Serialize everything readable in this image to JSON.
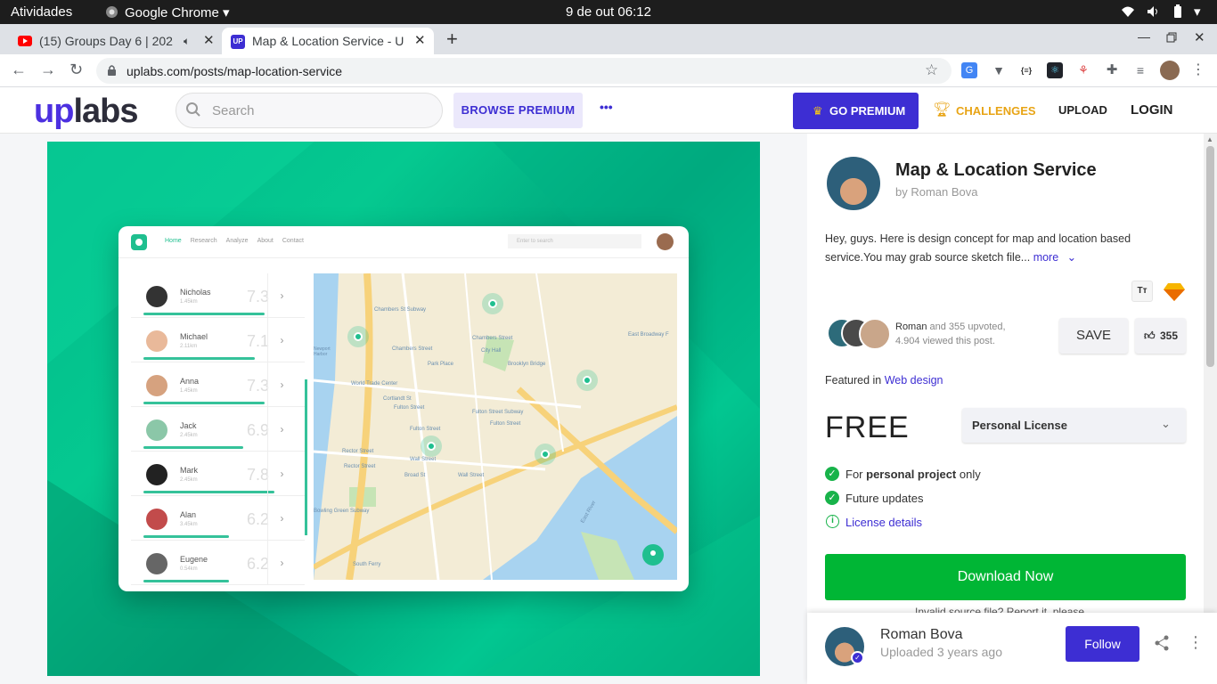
{
  "os": {
    "activities": "Atividades",
    "app_name": "Google Chrome",
    "datetime": "9 de out  06:12"
  },
  "browser": {
    "tabs": [
      {
        "title": "(15) Groups Day 6 | 202",
        "icon": "youtube-icon"
      },
      {
        "title": "Map & Location Service - U",
        "icon": "uplabs-favicon"
      }
    ],
    "new_tab": "+",
    "url": "uplabs.com/posts/map-location-service"
  },
  "site": {
    "logo_up": "up",
    "logo_labs": "labs",
    "search_placeholder": "Search",
    "browse_premium": "BROWSE PREMIUM",
    "more_dots": "•••",
    "go_premium": "GO PREMIUM",
    "challenges": "CHALLENGES",
    "upload": "UPLOAD",
    "login": "LOGIN"
  },
  "mockup": {
    "nav": [
      "Home",
      "Research",
      "Analyze",
      "About",
      "Contact"
    ],
    "search_placeholder": "Enter to search",
    "people": [
      {
        "name": "Nicholas",
        "dist": "1.45km",
        "score": "7.3",
        "fill": 0.85
      },
      {
        "name": "Michael",
        "dist": "2.11km",
        "score": "7.1",
        "fill": 0.78
      },
      {
        "name": "Anna",
        "dist": "1.45km",
        "score": "7.3",
        "fill": 0.85
      },
      {
        "name": "Jack",
        "dist": "2.45km",
        "score": "6.9",
        "fill": 0.7
      },
      {
        "name": "Mark",
        "dist": "2.45km",
        "score": "7.8",
        "fill": 0.92
      },
      {
        "name": "Alan",
        "dist": "3.45km",
        "score": "6.2",
        "fill": 0.6
      },
      {
        "name": "Eugene",
        "dist": "0.54km",
        "score": "6.2",
        "fill": 0.6
      }
    ],
    "map_labels": [
      "Chambers St Subway",
      "Chambers Street",
      "City Hall",
      "Park Place",
      "Brooklyn Bridge",
      "World Trade Center",
      "Cortlandt St",
      "Fulton Street",
      "Chambers Street",
      "Fulton Street Subway",
      "Fulton Street",
      "Fulton Street",
      "Rector Street",
      "Wall Street",
      "Rector Street",
      "Broad St",
      "Wall Street",
      "Bowling Green Subway",
      "South Ferry",
      "East River",
      "East Broadway F",
      "Newport Harbor"
    ]
  },
  "post": {
    "title": "Map & Location Service",
    "author_line": "by Roman Bova",
    "description": "Hey, guys. Here is design concept for map and location based service.You may grab source sketch file...",
    "more": "more",
    "tool_tt": "Tт",
    "upvoters_name": "Roman",
    "upvote_text": " and 355 upvoted,",
    "views_text": "4.904 viewed this post.",
    "save": "SAVE",
    "upvotes": "355",
    "featured_prefix": "Featured in ",
    "featured_link": "Web design",
    "price": "FREE",
    "license": "Personal License",
    "features": [
      {
        "pre": "For ",
        "bold": "personal project",
        "post": " only"
      },
      {
        "pre": "Future updates",
        "bold": "",
        "post": ""
      }
    ],
    "license_details": "License details",
    "download": "Download Now",
    "invalid_source": "Invalid source file? Report it, please"
  },
  "footer": {
    "author": "Roman Bova",
    "uploaded": "Uploaded 3 years ago",
    "follow": "Follow"
  },
  "colors": {
    "brand": "#3d2ed3",
    "green": "#00b635",
    "accent_link": "#3d2ed3",
    "challenge": "#e8a415"
  }
}
